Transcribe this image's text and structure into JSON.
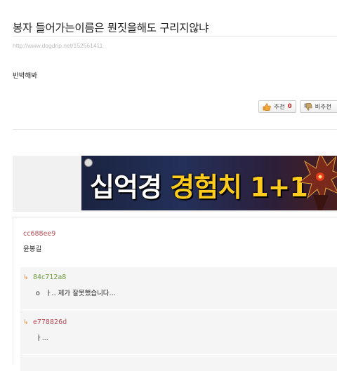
{
  "post": {
    "title": "봉자 들어가는이름은 뭔짓을해도 구리지않냐",
    "url": "http://www.dogdrip.net/152561411",
    "body": "반박해봐"
  },
  "votes": {
    "up_label": "추천",
    "up_count": "0",
    "down_label": "비추천"
  },
  "ad": {
    "text_white": "십억경",
    "text_yellow": "경험치 1+1",
    "colors": {
      "white_text": "#ffffff",
      "yellow_text": "#ffcc1e"
    }
  },
  "comments": [
    {
      "author": "cc688ee9",
      "text": "윤봉길"
    }
  ],
  "replies": [
    {
      "author": "84c712a8",
      "bullet": "o",
      "text": "ㅏ.. 제가 잘못했습니다..."
    },
    {
      "author": "e778826d",
      "text": "ㅏ..."
    }
  ],
  "colors": {
    "author_red": "#b54d55",
    "author_green": "#6f9a3a",
    "reply_arrow": "#e58a3a",
    "vote_count": "#d01818"
  },
  "icons": {
    "thumb_up": "thumbs-up-icon",
    "thumb_down": "thumbs-down-icon",
    "reply_arrow": "reply-arrow-icon"
  }
}
